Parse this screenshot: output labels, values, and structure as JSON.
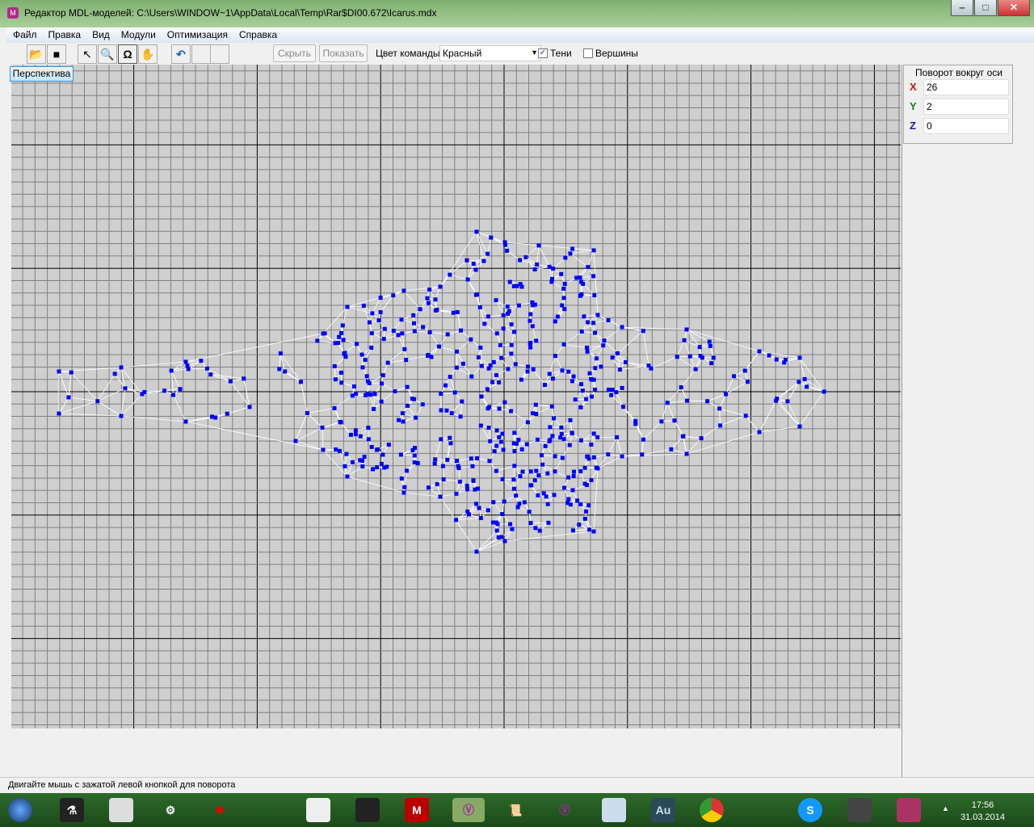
{
  "window": {
    "title": "Редактор MDL-моделей: C:\\Users\\WINDOW~1\\AppData\\Local\\Temp\\Rar$DI00.672\\Icarus.mdx",
    "minimize": "‒",
    "maximize": "□",
    "close": "✕"
  },
  "menu": [
    "Файл",
    "Правка",
    "Вид",
    "Модули",
    "Оптимизация",
    "Справка"
  ],
  "toolbar": {
    "hide_label": "Скрыть",
    "show_label": "Показать",
    "team_color_label": "Цвет команды:",
    "team_color_value": "Красный",
    "shadows_label": "Тени",
    "shadows_checked": true,
    "vertices_label": "Вершины",
    "vertices_checked": false
  },
  "viewport": {
    "view_button": "Перспектива",
    "colors": {
      "grid_bg": "#cfcfcf",
      "minor": "#808080",
      "major": "#000000",
      "mesh": "#ffffff",
      "vertex": "#0000ff"
    }
  },
  "rotation": {
    "title": "Поворот вокруг оси",
    "x_label": "X",
    "x": "26",
    "y_label": "Y",
    "y": "2",
    "z_label": "Z",
    "z": "0"
  },
  "status": "Двигайте мышь с зажатой левой кнопкой для поворота",
  "taskbar": {
    "time": "17:56",
    "date": "31.03.2014",
    "au_label": "Au",
    "tray_arrow": "▲"
  }
}
